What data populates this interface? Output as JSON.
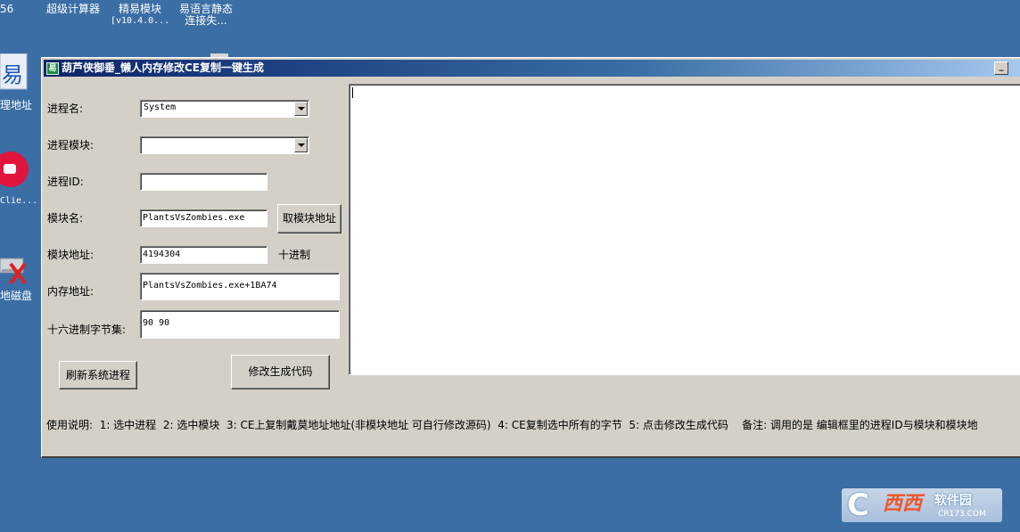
{
  "desktop": {
    "top_left_fragment": "56",
    "top_icons": [
      {
        "label": "超级计算器",
        "sub": ""
      },
      {
        "label": "精易模块",
        "sub": "[v10.4.0..."
      },
      {
        "label": "易语言静态",
        "sub": "连接失..."
      }
    ],
    "left_icons": [
      {
        "label": "理地址",
        "icon": "yi-language-icon"
      },
      {
        "label": "Clie...",
        "icon": "red-fist-app-icon"
      },
      {
        "label": "地磁盘",
        "icon": "drive-delete-icon"
      }
    ]
  },
  "window": {
    "title": "葫芦侠御垂_懒人内存修改CE复制一键生成",
    "title_icon_glyph": "易",
    "labels": {
      "process_name": "进程名:",
      "process_module": "进程模块:",
      "process_id": "进程ID:",
      "module_name": "模块名:",
      "module_address": "模块地址:",
      "memory_address": "内存地址:",
      "hex_bytes": "十六进制字节集:",
      "decimal": "十进制"
    },
    "process_name_value": "System",
    "process_module_value": "",
    "process_id_value": "",
    "module_name_value": "PlantsVsZombies.exe",
    "module_address_value": "4194304",
    "memory_address_value": "PlantsVsZombies.exe+1BA74",
    "hex_bytes_value": "90 90",
    "buttons": {
      "get_module_address": "取模块地址",
      "refresh_processes": "刷新系统进程",
      "generate_code": "修改生成代码"
    },
    "output_text": "",
    "instructions": {
      "prefix": "使用说明:",
      "s1": "1: 选中进程",
      "s2": "2:  选中模块",
      "s3": "3: CE上复制戴莫地址地址(非模块地址 可自行修改源码)",
      "s4": "4: CE复制选中所有的字节",
      "s5": "5: 点击修改生成代码",
      "note": "备注: 调用的是 编辑框里的进程ID与模块和模块地"
    }
  },
  "watermark": {
    "c": "C",
    "xixi": "西西",
    "brand": "软件园",
    "domain": "CR173.COM"
  },
  "colors": {
    "desktop": "#3a6ea5",
    "window_face": "#d4d0c8",
    "title_start": "#0a246a"
  }
}
